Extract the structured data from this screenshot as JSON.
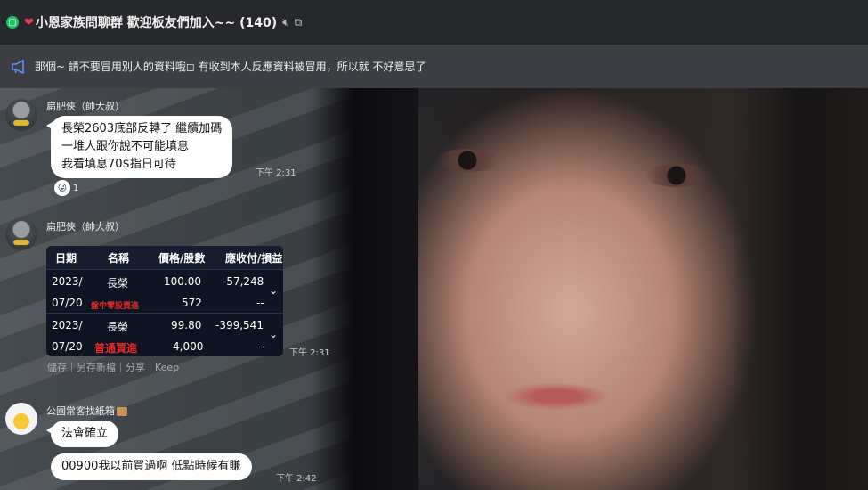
{
  "titlebar": {
    "app_icon": "line-icon",
    "title": "小恩家族問聊群 歡迎板友們加入~~ (140)",
    "icons": [
      "mute-icon",
      "popout-icon"
    ]
  },
  "announcement": {
    "icon": "megaphone-icon",
    "text": "那個~ 請不要冒用別人的資料哦◻ 有收到本人反應資料被冒用，所以就 不好意思了"
  },
  "messages": [
    {
      "sender": "扁肥俠（帥大叔）",
      "lines": [
        "長榮2603底部反轉了 繼續加碼",
        "一堆人跟你說不可能填息",
        "我看填息70$指日可待"
      ],
      "time": "下午 2:31",
      "reaction": {
        "icon": "wink-face-icon",
        "count": "1"
      }
    },
    {
      "sender": "扁肥俠（帥大叔）",
      "card": {
        "headers": [
          "日期",
          "名稱",
          "價格/股數",
          "應收付/損益"
        ],
        "rows": [
          {
            "date1": "2023/",
            "date2": "07/20",
            "name": "長榮",
            "type": "盤中零股買進",
            "price": "100.00",
            "shares": "572",
            "amount": "-57,248",
            "amount2": "--"
          },
          {
            "date1": "2023/",
            "date2": "07/20",
            "name": "長榮",
            "type": "普通買進",
            "price": "99.80",
            "shares": "4,000",
            "amount": "-399,541",
            "amount2": "--"
          }
        ]
      },
      "time": "下午 2:31",
      "actions": "儲存｜另存新檔｜分享｜Keep"
    },
    {
      "sender": "公園常客找紙箱",
      "bubbles": [
        "法會確立",
        "00900我以前買過啊 低點時候有賺"
      ],
      "time": "下午 2:42"
    }
  ]
}
